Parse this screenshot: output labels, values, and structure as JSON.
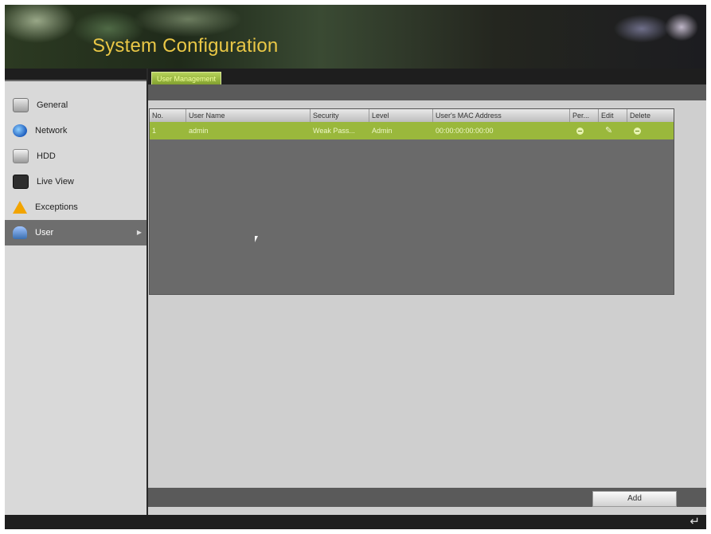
{
  "window": {
    "title": "System Configuration"
  },
  "tabs": [
    {
      "label": "User Management"
    }
  ],
  "sidebar": {
    "items": [
      {
        "label": "General",
        "icon": "gear-icon"
      },
      {
        "label": "Network",
        "icon": "network-globe-icon"
      },
      {
        "label": "HDD",
        "icon": "hdd-icon"
      },
      {
        "label": "Live View",
        "icon": "monitor-icon"
      },
      {
        "label": "Exceptions",
        "icon": "warning-icon"
      },
      {
        "label": "User",
        "icon": "users-icon",
        "selected": true
      }
    ]
  },
  "table": {
    "columns": [
      "No.",
      "User Name",
      "Security",
      "Level",
      "User's MAC Address",
      "Per...",
      "Edit",
      "Delete"
    ],
    "rows": [
      {
        "no": "1",
        "user_name": "admin",
        "security": "Weak Pass...",
        "level": "Admin",
        "mac": "00:00:00:00:00:00"
      }
    ]
  },
  "buttons": {
    "add": "Add"
  },
  "colors": {
    "accent": "#9ab83c",
    "title": "#e9c746"
  }
}
